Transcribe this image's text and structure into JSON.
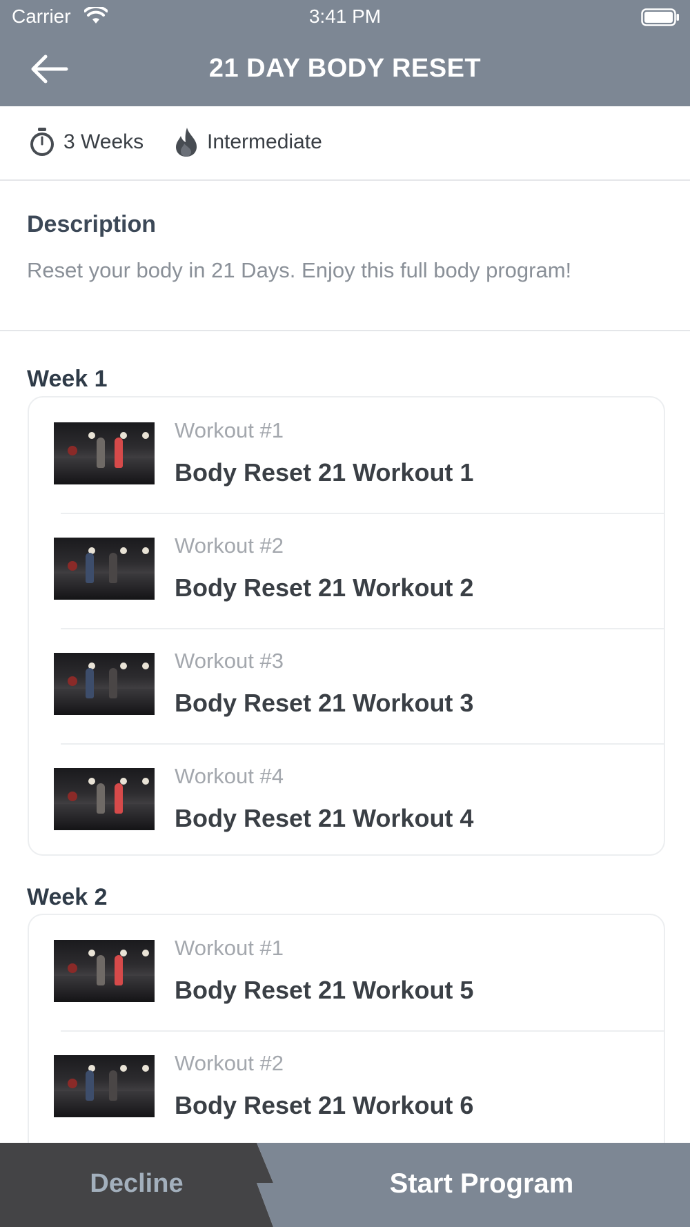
{
  "status_bar": {
    "carrier": "Carrier",
    "time": "3:41 PM"
  },
  "header": {
    "title": "21 DAY BODY RESET"
  },
  "meta": {
    "duration": "3 Weeks",
    "level": "Intermediate"
  },
  "description": {
    "title": "Description",
    "text": "Reset your body in 21 Days. Enjoy this full body program!"
  },
  "weeks": [
    {
      "title": "Week 1",
      "workouts": [
        {
          "label": "Workout #1",
          "name": "Body Reset 21 Workout 1"
        },
        {
          "label": "Workout #2",
          "name": "Body Reset 21 Workout 2"
        },
        {
          "label": "Workout #3",
          "name": "Body Reset 21 Workout 3"
        },
        {
          "label": "Workout #4",
          "name": "Body Reset 21 Workout 4"
        }
      ]
    },
    {
      "title": "Week 2",
      "workouts": [
        {
          "label": "Workout #1",
          "name": "Body Reset 21 Workout 5"
        },
        {
          "label": "Workout #2",
          "name": "Body Reset 21 Workout 6"
        }
      ]
    }
  ],
  "actions": {
    "decline": "Decline",
    "start": "Start Program"
  },
  "colors": {
    "header": "#7d8794",
    "decline_bg": "#444446",
    "decline_text": "#a3b0bd"
  },
  "icons": {
    "back": "arrow-left-icon",
    "duration": "stopwatch-icon",
    "level": "flame-icon",
    "wifi": "wifi-icon",
    "battery": "battery-icon"
  }
}
